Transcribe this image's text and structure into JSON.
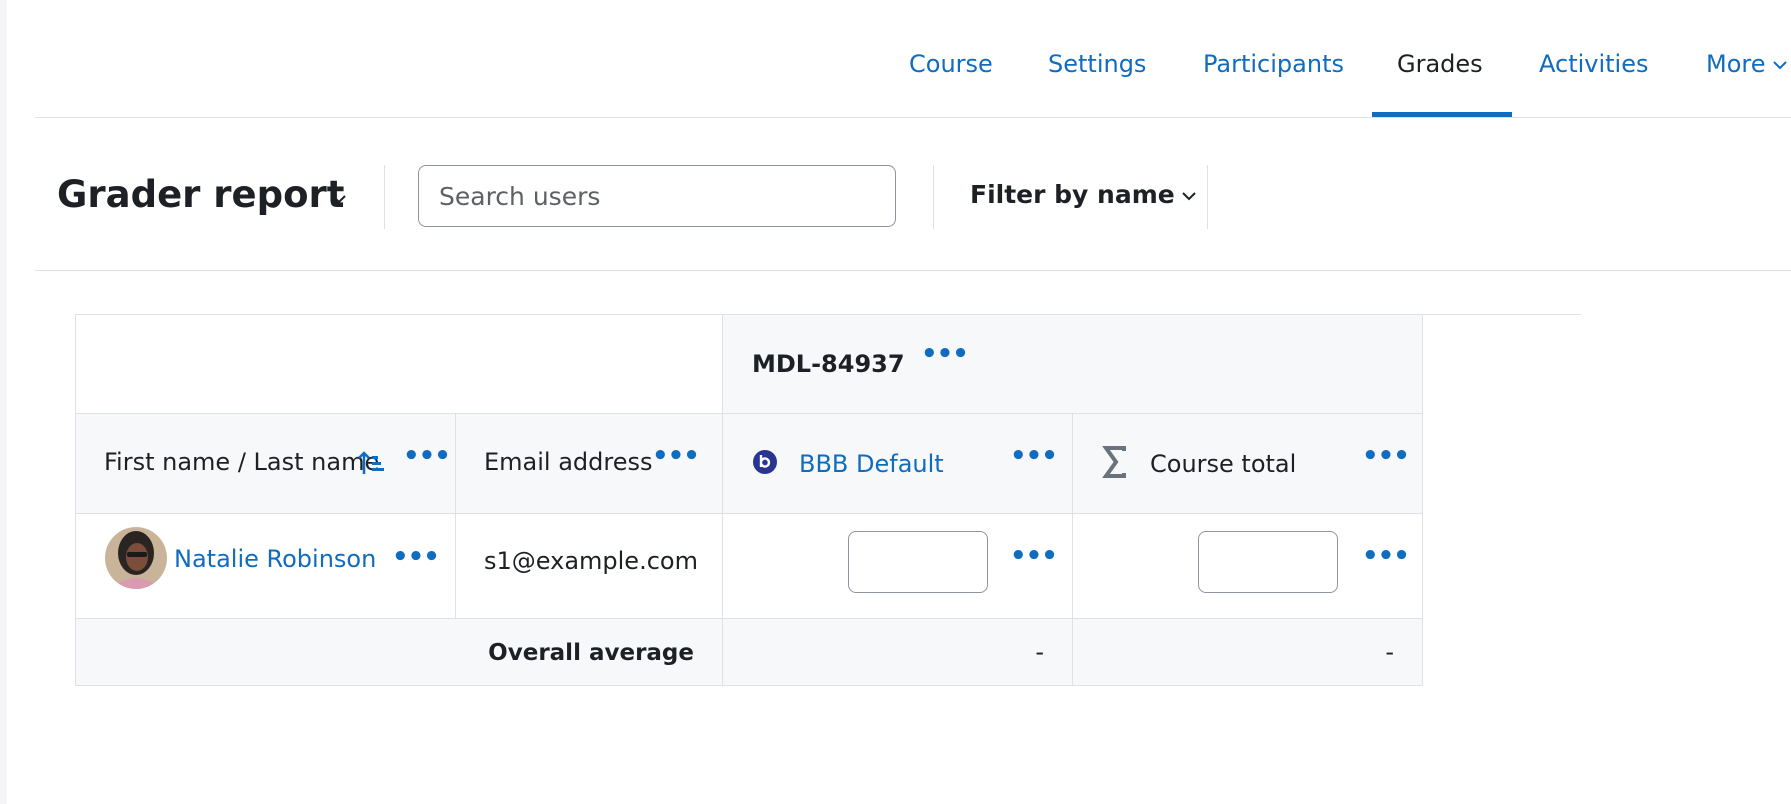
{
  "nav": {
    "items": [
      {
        "label": "Course"
      },
      {
        "label": "Settings"
      },
      {
        "label": "Participants"
      },
      {
        "label": "Grades"
      },
      {
        "label": "Activities"
      },
      {
        "label": "More"
      }
    ],
    "active": "Grades"
  },
  "actionbar": {
    "title": "Grader report",
    "search_placeholder": "Search users",
    "filter_label": "Filter by name"
  },
  "table": {
    "category": "MDL-84937",
    "columns": {
      "name": "First name / Last name",
      "email": "Email address",
      "item": "BBB Default",
      "total": "Course total"
    },
    "rows": [
      {
        "name": "Natalie Robinson",
        "email": "s1@example.com",
        "item_grade": "",
        "total_grade": ""
      }
    ],
    "average": {
      "label": "Overall average",
      "item": "-",
      "total": "-"
    }
  },
  "icons": {
    "sort": "sort-ascending-icon",
    "actions": "more-actions-icon",
    "bbb": "bigbluebutton-icon",
    "total": "sigma-icon"
  },
  "colors": {
    "link": "#0f6cbf",
    "text": "#1d2125",
    "border": "#dee2e6",
    "header_bg": "#f7f8fa",
    "bbb_icon": "#283593"
  }
}
